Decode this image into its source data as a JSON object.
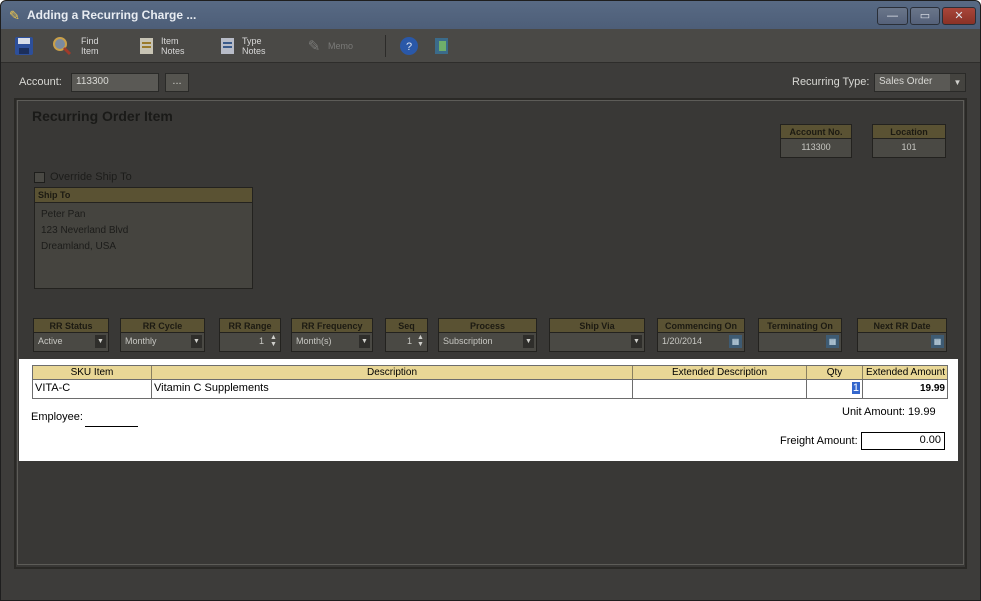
{
  "window": {
    "title": "Adding a Recurring Charge ...",
    "controls": {
      "minimize": "—",
      "maximize": "▭",
      "close": "✕"
    }
  },
  "toolbar": {
    "items": [
      {
        "icon": "save-icon",
        "label": ""
      },
      {
        "icon": "search-icon",
        "label": ""
      },
      {
        "icon": "find-item-icon",
        "label": "Find\nItem"
      },
      {
        "icon": "item-notes-icon",
        "label": "Item\nNotes"
      },
      {
        "icon": "type-notes-icon",
        "label": "Type\nNotes"
      },
      {
        "icon": "memo-icon",
        "label": "Memo",
        "disabled": true
      },
      {
        "icon": "help-icon",
        "label": ""
      },
      {
        "icon": "exit-icon",
        "label": ""
      }
    ]
  },
  "account": {
    "label": "Account:",
    "value": "113300",
    "browse": "..."
  },
  "recurring_type": {
    "label": "Recurring Type:",
    "value": "Sales Order"
  },
  "section": {
    "title": "Recurring Order Item"
  },
  "account_no": {
    "label": "Account No.",
    "value": "113300"
  },
  "location": {
    "label": "Location",
    "value": "101"
  },
  "ship_to": {
    "override_label": "Override Ship To",
    "header": "Ship To",
    "lines": [
      "Peter Pan",
      "123 Neverland Blvd",
      "Dreamland, USA"
    ]
  },
  "fields": {
    "rr_status": {
      "label": "RR Status",
      "value": "Active"
    },
    "rr_cycle": {
      "label": "RR Cycle",
      "value": "Monthly"
    },
    "rr_range": {
      "label": "RR Range",
      "value": "1"
    },
    "rr_frequency": {
      "label": "RR Frequency",
      "value": "Month(s)"
    },
    "seq": {
      "label": "Seq",
      "value": "1"
    },
    "process": {
      "label": "Process",
      "value": "Subscription"
    },
    "ship_via": {
      "label": "Ship Via",
      "value": ""
    },
    "commencing_on": {
      "label": "Commencing On",
      "value": "1/20/2014"
    },
    "terminating_on": {
      "label": "Terminating On",
      "value": ""
    },
    "next_rr_date": {
      "label": "Next RR Date",
      "value": ""
    }
  },
  "grid": {
    "headers": {
      "sku": "SKU Item",
      "description": "Description",
      "extended_description": "Extended Description",
      "qty": "Qty",
      "extended_amount": "Extended Amount"
    },
    "rows": [
      {
        "sku": "VITA-C",
        "description": "Vitamin C Supplements",
        "extended_description": "",
        "qty": "1",
        "extended_amount": "19.99"
      }
    ]
  },
  "employee": {
    "label": "Employee:",
    "value": ""
  },
  "unit_amount": {
    "text": "Unit Amount: 19.99"
  },
  "freight": {
    "label": "Freight Amount:",
    "value": "0.00"
  },
  "colors": {
    "header_gold": "#e9d796",
    "dim_overlay": "#393836",
    "selection": "#3366cc"
  }
}
